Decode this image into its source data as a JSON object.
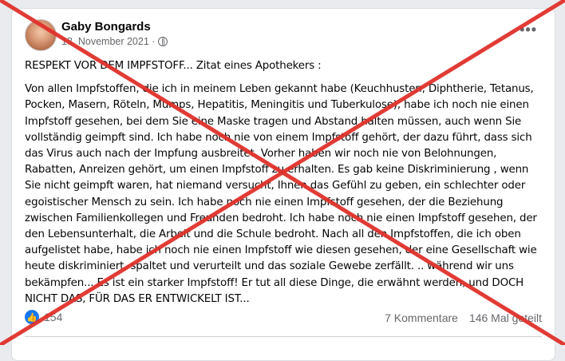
{
  "post": {
    "author": "Gaby Bongards",
    "date": "18. November 2021 ·",
    "more_icon": "more-options-icon",
    "headline": "RESPEKT VOR DEM IMPFSTOFF... Zitat eines Apothekers :",
    "body": "Von allen Impfstoffen, die ich in meinem Leben gekannt habe (Keuchhusten, Diphtherie, Tetanus, Pocken, Masern, Röteln, Mumps, Hepatitis, Meningitis und Tuberkulose), habe ich noch nie einen Impfstoff gesehen, bei dem Sie eine Maske tragen und Abstand halten müssen, auch wenn Sie vollständig geimpft sind. Ich habe noch nie von einem Impfstoff gehört, der dazu führt, dass sich das Virus auch nach der Impfung ausbreitet. Vorher haben wir noch nie von Belohnungen, Rabatten, Anreizen gehört, um einen Impfstoff zu erhalten. Es gab keine Diskriminierung , wenn Sie nicht geimpft waren, hat niemand versucht, Ihnen das Gefühl zu geben, ein schlechter oder egoistischer Mensch zu sein. Ich habe noch nie einen Impfstoff gesehen, der die Beziehung zwischen Familienkollegen und Freunden bedroht. Ich habe noch nie einen Impfstoff gesehen, der den Lebensunterhalt, die Arbeit und die Schule bedroht. Nach all den Impfstoffen, die ich oben aufgelistet habe, habe ich noch nie einen Impfstoff wie diesen gesehen, der eine Gesellschaft wie heute diskriminiert, spaltet und verurteilt und das soziale Gewebe zerfällt. .. während wir uns bekämpfen... Es ist ein starker Impfstoff! Er tut all diese Dinge, die erwähnt werden, und DOCH NICHT DAS, FÜR DAS ER ENTWICKELT IST...",
    "reactions_count": "154",
    "comments": "7 Kommentare",
    "shares": "146 Mal geteilt"
  },
  "colors": {
    "cross": "#e0312b",
    "reaction_blue": "#1877f2",
    "meta_gray": "#65676b"
  }
}
